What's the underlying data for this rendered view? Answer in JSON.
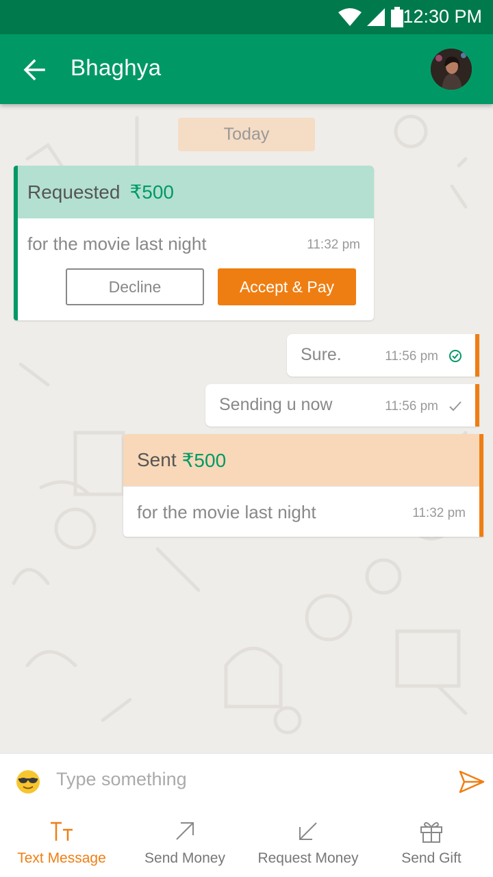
{
  "status_bar": {
    "time": "12:30 PM"
  },
  "header": {
    "title": "Bhaghya"
  },
  "chat": {
    "date_label": "Today",
    "request_card": {
      "label": "Requested",
      "amount": "₹500",
      "note": "for the movie last night",
      "time": "11:32 pm",
      "decline_label": "Decline",
      "accept_label": "Accept & Pay"
    },
    "messages": [
      {
        "text": "Sure.",
        "time": "11:56 pm",
        "status_icon": "check-circle-icon"
      },
      {
        "text": "Sending u now",
        "time": "11:56 pm",
        "status_icon": "check-icon"
      }
    ],
    "sent_card": {
      "label": "Sent",
      "amount": "₹500",
      "note": "for the movie last night",
      "time": "11:32 pm"
    }
  },
  "composer": {
    "placeholder": "Type something"
  },
  "tabs": [
    {
      "label": "Text Message",
      "icon": "text-format-icon",
      "active": true
    },
    {
      "label": "Send Money",
      "icon": "arrow-up-right-icon",
      "active": false
    },
    {
      "label": "Request Money",
      "icon": "arrow-down-left-icon",
      "active": false
    },
    {
      "label": "Send Gift",
      "icon": "gift-icon",
      "active": false
    }
  ],
  "colors": {
    "primary": "#009966",
    "status_bar": "#007a4d",
    "accent": "#ef7e12"
  }
}
